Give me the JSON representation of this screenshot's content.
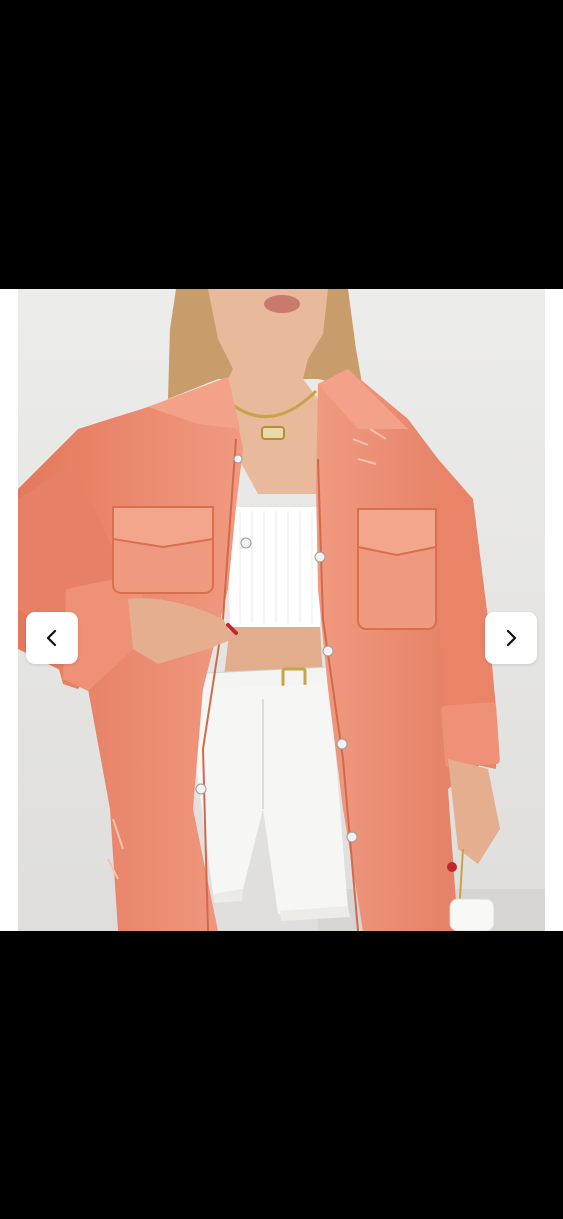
{
  "viewer": {
    "background": "#000000",
    "prev_icon": "chevron-left-icon",
    "next_icon": "chevron-right-icon"
  },
  "photo": {
    "subject": "product-photo",
    "colors": {
      "jacket": "#ec8a6f",
      "top": "#ffffff",
      "shorts": "#f6f6f4",
      "wall": "#e9e9e7"
    }
  }
}
